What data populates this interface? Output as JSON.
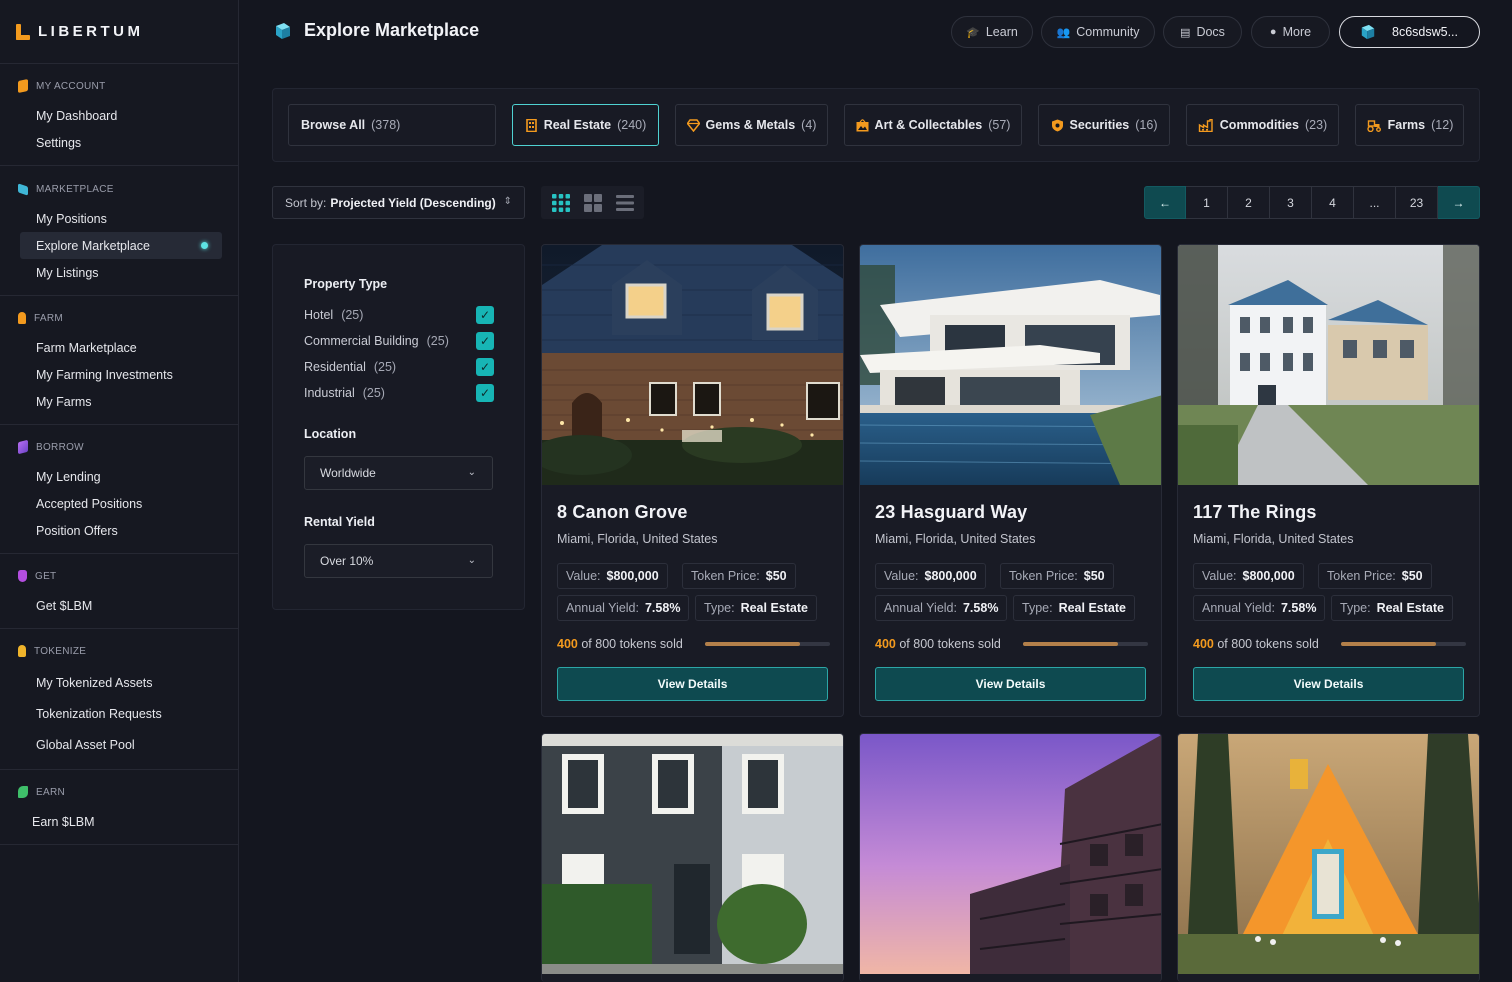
{
  "app": {
    "logo_text": "LIBERTUM"
  },
  "sidebar": {
    "sections": [
      {
        "label": "MY ACCOUNT",
        "color": "#f39a1e",
        "items": [
          "My Dashboard",
          "Settings"
        ]
      },
      {
        "label": "MARKETPLACE",
        "color": "#3fb6d6",
        "items": [
          "My Positions",
          "Explore Marketplace",
          "My Listings"
        ],
        "active": "Explore Marketplace"
      },
      {
        "label": "FARM",
        "color": "#f39a1e",
        "items": [
          "Farm Marketplace",
          "My Farming Investments",
          "My Farms"
        ]
      },
      {
        "label": "BORROW",
        "color": "#8e5ad6",
        "items": [
          "My Lending",
          "Accepted Positions",
          "Position Offers"
        ]
      },
      {
        "label": "GET",
        "color": "#b44ee0",
        "items": [
          "Get $LBM"
        ]
      },
      {
        "label": "TOKENIZE",
        "color": "#f0b42b",
        "items": [
          "My Tokenized Assets",
          "Tokenization Requests",
          "Global Asset Pool"
        ]
      },
      {
        "label": "EARN",
        "color": "#3fbf6a",
        "items": [
          "Earn $LBM"
        ]
      }
    ]
  },
  "header": {
    "title": "Explore Marketplace",
    "buttons": {
      "learn": "Learn",
      "community": "Community",
      "docs": "Docs",
      "more": "More"
    },
    "wallet": "8c6sdsw5..."
  },
  "categories": [
    {
      "label": "Browse All",
      "count": "(378)"
    },
    {
      "label": "Real Estate",
      "count": "(240)"
    },
    {
      "label": "Gems & Metals",
      "count": "(4)"
    },
    {
      "label": "Art & Collectables",
      "count": "(57)"
    },
    {
      "label": "Securities",
      "count": "(16)"
    },
    {
      "label": "Commodities",
      "count": "(23)"
    },
    {
      "label": "Farms",
      "count": "(12)"
    }
  ],
  "toolbar": {
    "sort_prefix": "Sort by:",
    "sort_value": "Projected Yield (Descending)",
    "pages": [
      "1",
      "2",
      "3",
      "4",
      "...",
      "23"
    ]
  },
  "filters": {
    "property_type_title": "Property Type",
    "property_types": [
      {
        "label": "Hotel",
        "count": "(25)"
      },
      {
        "label": "Commercial Building",
        "count": "(25)"
      },
      {
        "label": "Residential",
        "count": "(25)"
      },
      {
        "label": "Industrial",
        "count": "(25)"
      }
    ],
    "location_title": "Location",
    "location_value": "Worldwide",
    "yield_title": "Rental Yield",
    "yield_value": "Over 10%"
  },
  "labels": {
    "value": "Value:",
    "token_price": "Token Price:",
    "annual_yield": "Annual Yield:",
    "type": "Type:",
    "of": "of",
    "tokens_sold": "tokens sold",
    "view_details": "View Details"
  },
  "cards": [
    {
      "name": "8 Canon Grove",
      "location": "Miami, Florida, United States",
      "value": "$800,000",
      "token_price": "$50",
      "annual_yield": "7.58%",
      "type": "Real Estate",
      "sold": "400",
      "total": "800",
      "progress": 0.76
    },
    {
      "name": "23 Hasguard Way",
      "location": "Miami, Florida, United States",
      "value": "$800,000",
      "token_price": "$50",
      "annual_yield": "7.58%",
      "type": "Real Estate",
      "sold": "400",
      "total": "800",
      "progress": 0.76
    },
    {
      "name": "117 The Rings",
      "location": "Miami, Florida, United States",
      "value": "$800,000",
      "token_price": "$50",
      "annual_yield": "7.58%",
      "type": "Real Estate",
      "sold": "400",
      "total": "800",
      "progress": 0.76
    }
  ]
}
